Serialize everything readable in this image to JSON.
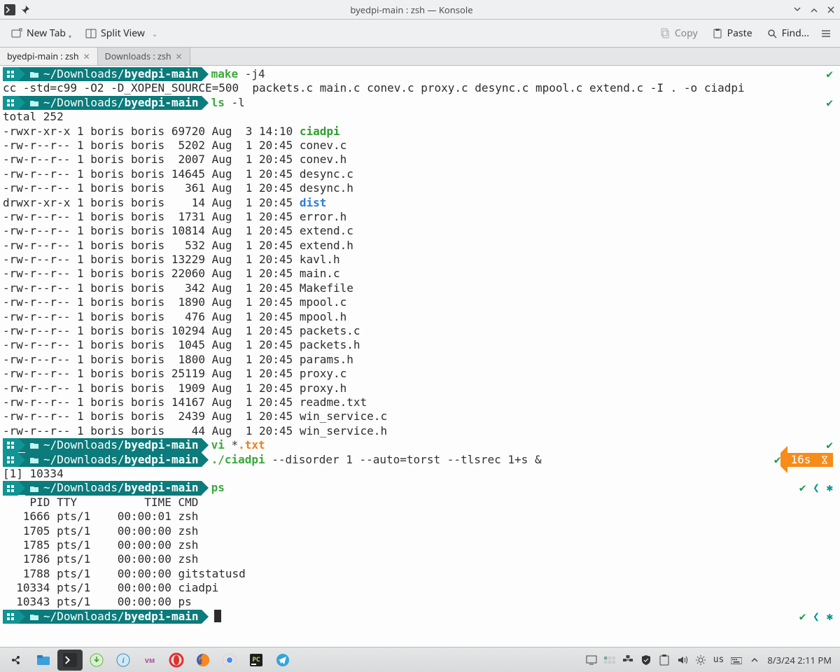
{
  "window": {
    "title": "byedpi-main : zsh — Konsole"
  },
  "toolbar": {
    "new_tab": "New Tab",
    "split_view": "Split View",
    "copy": "Copy",
    "paste": "Paste",
    "find": "Find..."
  },
  "tabs": [
    {
      "label": "byedpi-main : zsh",
      "active": true
    },
    {
      "label": "Downloads : zsh",
      "active": false
    }
  ],
  "prompt": {
    "host_glyph": "⌂",
    "path_display": "~/Downloads/",
    "path_bold": "byedpi-main"
  },
  "lines": [
    {
      "type": "prompt",
      "cmd_green": "make",
      "cmd_rest": " -j4",
      "right": "check"
    },
    {
      "type": "plain",
      "text": "cc -std=c99 -O2 -D_XOPEN_SOURCE=500  packets.c main.c conev.c proxy.c desync.c mpool.c extend.c -I . -o ciadpi"
    },
    {
      "type": "prompt",
      "cmd_green": "ls",
      "cmd_rest": " -l",
      "right": "check"
    },
    {
      "type": "plain",
      "text": "total 252"
    },
    {
      "type": "ls",
      "perm": "-rwxr-xr-x 1 boris boris 69720 Aug  3 14:10 ",
      "name": "ciadpi",
      "cls": "fg-green-exe"
    },
    {
      "type": "ls",
      "perm": "-rw-r--r-- 1 boris boris  5202 Aug  1 20:45 ",
      "name": "conev.c"
    },
    {
      "type": "ls",
      "perm": "-rw-r--r-- 1 boris boris  2007 Aug  1 20:45 ",
      "name": "conev.h"
    },
    {
      "type": "ls",
      "perm": "-rw-r--r-- 1 boris boris 14645 Aug  1 20:45 ",
      "name": "desync.c"
    },
    {
      "type": "ls",
      "perm": "-rw-r--r-- 1 boris boris   361 Aug  1 20:45 ",
      "name": "desync.h"
    },
    {
      "type": "ls",
      "perm": "drwxr-xr-x 1 boris boris    14 Aug  1 20:45 ",
      "name": "dist",
      "cls": "fg-blue"
    },
    {
      "type": "ls",
      "perm": "-rw-r--r-- 1 boris boris  1731 Aug  1 20:45 ",
      "name": "error.h"
    },
    {
      "type": "ls",
      "perm": "-rw-r--r-- 1 boris boris 10814 Aug  1 20:45 ",
      "name": "extend.c"
    },
    {
      "type": "ls",
      "perm": "-rw-r--r-- 1 boris boris   532 Aug  1 20:45 ",
      "name": "extend.h"
    },
    {
      "type": "ls",
      "perm": "-rw-r--r-- 1 boris boris 13229 Aug  1 20:45 ",
      "name": "kavl.h"
    },
    {
      "type": "ls",
      "perm": "-rw-r--r-- 1 boris boris 22060 Aug  1 20:45 ",
      "name": "main.c"
    },
    {
      "type": "ls",
      "perm": "-rw-r--r-- 1 boris boris   342 Aug  1 20:45 ",
      "name": "Makefile"
    },
    {
      "type": "ls",
      "perm": "-rw-r--r-- 1 boris boris  1890 Aug  1 20:45 ",
      "name": "mpool.c"
    },
    {
      "type": "ls",
      "perm": "-rw-r--r-- 1 boris boris   476 Aug  1 20:45 ",
      "name": "mpool.h"
    },
    {
      "type": "ls",
      "perm": "-rw-r--r-- 1 boris boris 10294 Aug  1 20:45 ",
      "name": "packets.c"
    },
    {
      "type": "ls",
      "perm": "-rw-r--r-- 1 boris boris  1045 Aug  1 20:45 ",
      "name": "packets.h"
    },
    {
      "type": "ls",
      "perm": "-rw-r--r-- 1 boris boris  1800 Aug  1 20:45 ",
      "name": "params.h"
    },
    {
      "type": "ls",
      "perm": "-rw-r--r-- 1 boris boris 25119 Aug  1 20:45 ",
      "name": "proxy.c"
    },
    {
      "type": "ls",
      "perm": "-rw-r--r-- 1 boris boris  1909 Aug  1 20:45 ",
      "name": "proxy.h"
    },
    {
      "type": "ls",
      "perm": "-rw-r--r-- 1 boris boris 14167 Aug  1 20:45 ",
      "name": "readme.txt"
    },
    {
      "type": "ls",
      "perm": "-rw-r--r-- 1 boris boris  2439 Aug  1 20:45 ",
      "name": "win_service.c"
    },
    {
      "type": "ls",
      "perm": "-rw-r--r-- 1 boris boris    44 Aug  1 20:45 ",
      "name": "win_service.h"
    },
    {
      "type": "prompt",
      "cmd_green": "vi",
      "cmd_rest": " *",
      "cmd_orange": ".txt",
      "right": "check"
    },
    {
      "type": "prompt",
      "cmd_green": "./ciadpi",
      "cmd_rest": " --disorder 1 --auto=torst --tlsrec 1+s &",
      "right": "timer",
      "timer_label": "16s"
    },
    {
      "type": "plain",
      "text": "[1] 10334"
    },
    {
      "type": "prompt",
      "cmd_green": "ps",
      "cmd_rest": "",
      "right": "gear"
    },
    {
      "type": "plain",
      "text": "    PID TTY          TIME CMD"
    },
    {
      "type": "plain",
      "text": "   1666 pts/1    00:00:01 zsh"
    },
    {
      "type": "plain",
      "text": "   1705 pts/1    00:00:00 zsh"
    },
    {
      "type": "plain",
      "text": "   1785 pts/1    00:00:00 zsh"
    },
    {
      "type": "plain",
      "text": "   1786 pts/1    00:00:00 zsh"
    },
    {
      "type": "plain",
      "text": "   1788 pts/1    00:00:00 gitstatusd"
    },
    {
      "type": "plain",
      "text": "  10334 pts/1    00:00:00 ciadpi"
    },
    {
      "type": "plain",
      "text": "  10343 pts/1    00:00:00 ps"
    },
    {
      "type": "prompt",
      "cmd_green": "",
      "cmd_rest": "",
      "right": "gear",
      "cursor": true
    }
  ],
  "taskbar": {
    "lang": "us",
    "clock": "8/3/24 2:11 PM"
  },
  "colors": {
    "teal": "#109494",
    "teal_dark": "#0b7b7b",
    "green": "#3aa93a",
    "blue": "#2c7bdc",
    "orange": "#e78221",
    "amber": "#f78c1a"
  }
}
